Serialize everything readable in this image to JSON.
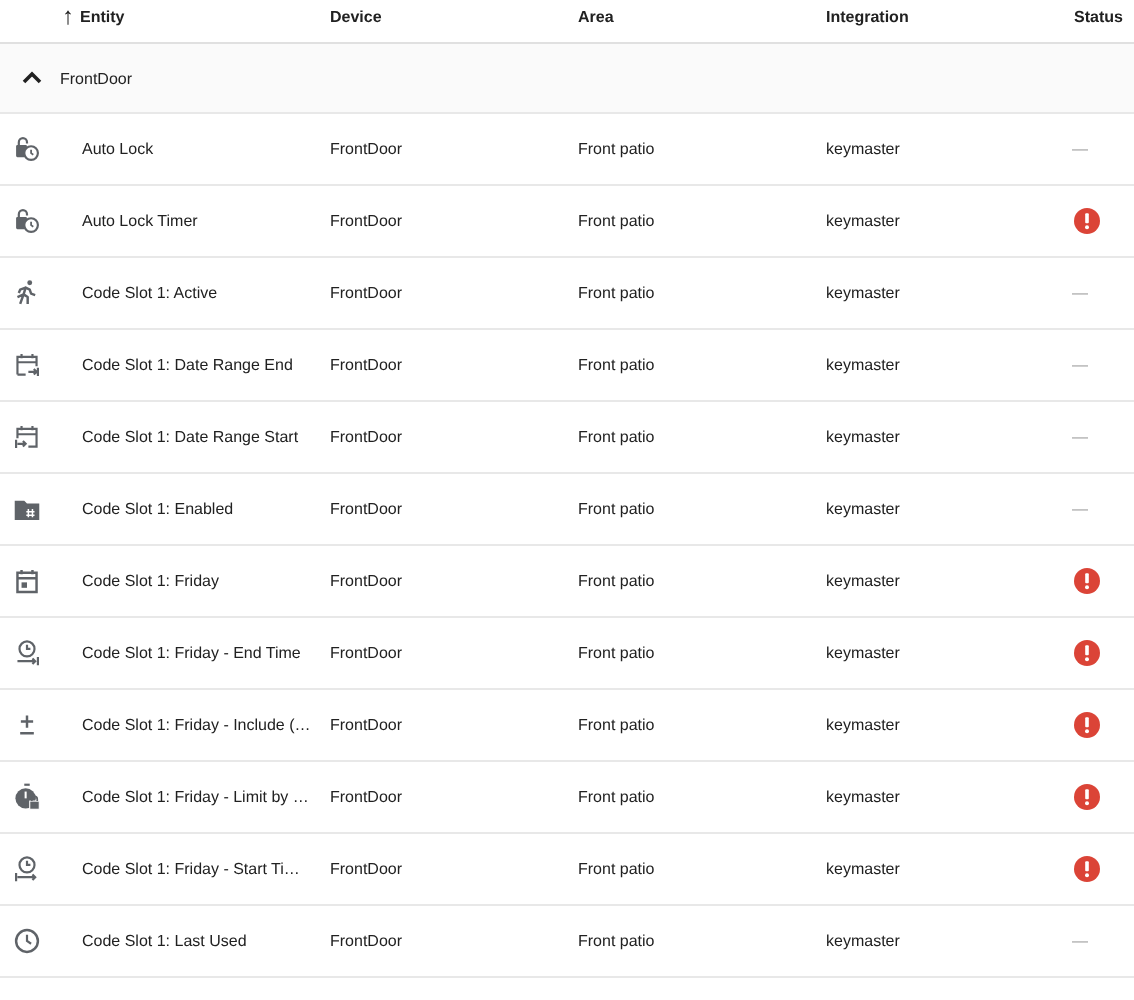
{
  "table": {
    "sort_arrow": "↑",
    "columns": [
      "Entity",
      "Device",
      "Area",
      "Integration",
      "Status"
    ],
    "groups": [
      {
        "name": "FrontDoor",
        "expanded": true,
        "rows": [
          {
            "kind": "lock-clock",
            "entity": "Auto Lock",
            "device": "FrontDoor",
            "area": "Front patio",
            "integration": "keymaster",
            "status": {
              "kind": "none",
              "text": "—"
            }
          },
          {
            "kind": "lock-clock",
            "entity": "Auto Lock Timer",
            "device": "FrontDoor",
            "area": "Front patio",
            "integration": "keymaster",
            "status": {
              "kind": "error"
            }
          },
          {
            "kind": "run",
            "entity": "Code Slot 1: Active",
            "device": "FrontDoor",
            "area": "Front patio",
            "integration": "keymaster",
            "status": {
              "kind": "none",
              "text": "—"
            }
          },
          {
            "kind": "calendar-end",
            "entity": "Code Slot 1: Date Range End",
            "device": "FrontDoor",
            "area": "Front patio",
            "integration": "keymaster",
            "status": {
              "kind": "none",
              "text": "—"
            }
          },
          {
            "kind": "calendar-start",
            "entity": "Code Slot 1: Date Range Start",
            "device": "FrontDoor",
            "area": "Front patio",
            "integration": "keymaster",
            "status": {
              "kind": "none",
              "text": "—"
            }
          },
          {
            "kind": "folder-hash",
            "entity": "Code Slot 1: Enabled",
            "device": "FrontDoor",
            "area": "Front patio",
            "integration": "keymaster",
            "status": {
              "kind": "none",
              "text": "—"
            }
          },
          {
            "kind": "calendar",
            "entity": "Code Slot 1: Friday",
            "device": "FrontDoor",
            "area": "Front patio",
            "integration": "keymaster",
            "status": {
              "kind": "error"
            }
          },
          {
            "kind": "clock-end",
            "entity": "Code Slot 1: Friday - End Time",
            "device": "FrontDoor",
            "area": "Front patio",
            "integration": "keymaster",
            "status": {
              "kind": "error"
            }
          },
          {
            "kind": "plus-minus",
            "entity": "Code Slot 1: Friday - Include (…",
            "device": "FrontDoor",
            "area": "Front patio",
            "integration": "keymaster",
            "status": {
              "kind": "error"
            }
          },
          {
            "kind": "timer-lock",
            "entity": "Code Slot 1: Friday - Limit by …",
            "device": "FrontDoor",
            "area": "Front patio",
            "integration": "keymaster",
            "status": {
              "kind": "error"
            }
          },
          {
            "kind": "clock-start",
            "entity": "Code Slot 1: Friday - Start Ti…",
            "device": "FrontDoor",
            "area": "Front patio",
            "integration": "keymaster",
            "status": {
              "kind": "error"
            }
          },
          {
            "kind": "clock",
            "entity": "Code Slot 1: Last Used",
            "device": "FrontDoor",
            "area": "Front patio",
            "integration": "keymaster",
            "status": {
              "kind": "none",
              "text": "—"
            }
          }
        ]
      }
    ]
  }
}
